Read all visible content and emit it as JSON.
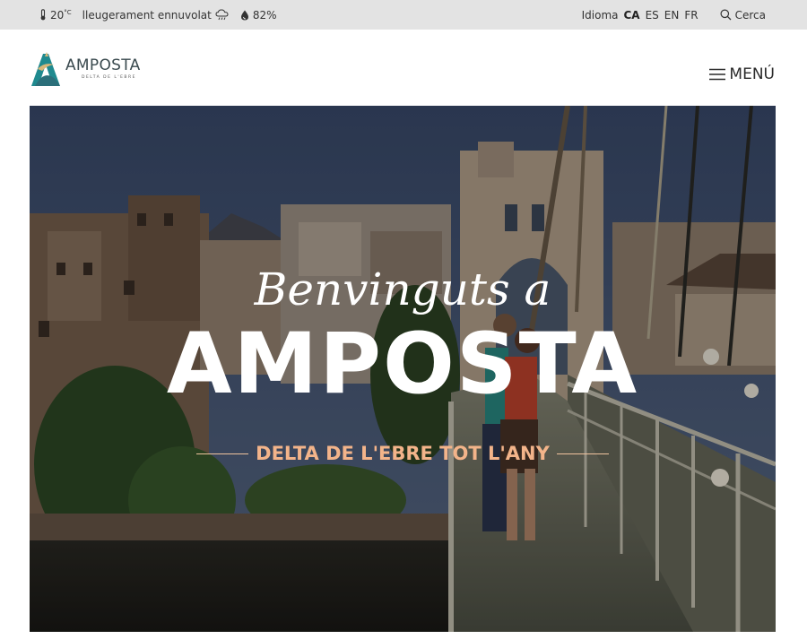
{
  "topbar": {
    "temperature": "20",
    "temp_unit": "°C",
    "weather_desc": "lleugerament ennuvolat",
    "humidity": "82%",
    "language_label": "Idioma",
    "languages": [
      {
        "code": "CA",
        "active": true
      },
      {
        "code": "ES",
        "active": false
      },
      {
        "code": "EN",
        "active": false
      },
      {
        "code": "FR",
        "active": false
      }
    ],
    "search_label": "Cerca"
  },
  "header": {
    "logo_name": "AMPOSTA",
    "logo_sub": "DELTA DE L'EBRE",
    "menu_label": "MENÚ"
  },
  "hero": {
    "welcome": "Benvinguts a",
    "title": "AMPOSTA",
    "subtitle": "DELTA DE L'EBRE TOT L'ANY"
  },
  "colors": {
    "topbar_bg": "#e3e3e3",
    "accent": "#f3b48a",
    "logo_teal": "#1f8a8f",
    "logo_sand": "#d9b77a"
  },
  "icons": {
    "thermometer": "thermometer-icon",
    "weather": "cloud-rain-icon",
    "humidity": "drop-icon",
    "search": "search-icon",
    "menu": "hamburger-icon"
  }
}
